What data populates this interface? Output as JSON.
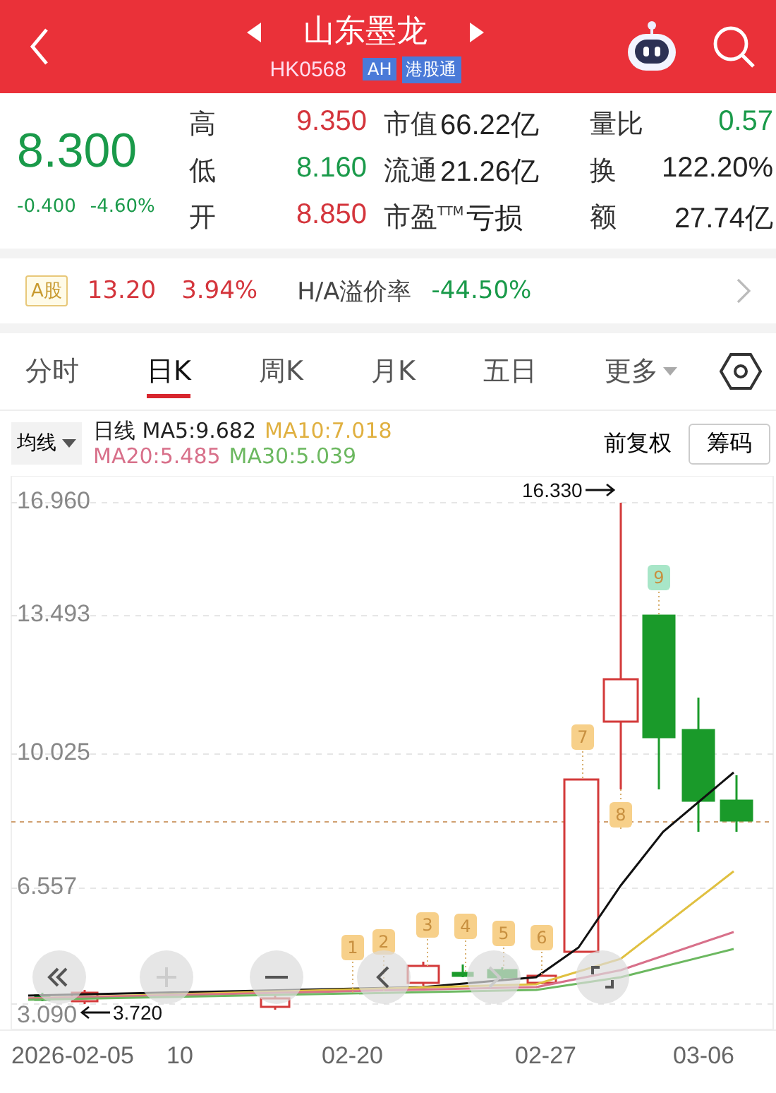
{
  "header": {
    "title": "山东墨龙",
    "code": "HK0568",
    "tags": [
      "AH",
      "港股通"
    ]
  },
  "quote": {
    "price": "8.300",
    "change": "-0.400",
    "change_pct": "-4.60%",
    "color": "#1a9a4a",
    "stats": [
      {
        "label": "高",
        "value": "9.350",
        "color": "#d4353c"
      },
      {
        "label": "市值",
        "value": "66.22亿",
        "color": "#222222"
      },
      {
        "label": "量比",
        "value": "0.57",
        "color": "#1a9a4a"
      },
      {
        "label": "低",
        "value": "8.160",
        "color": "#1a9a4a"
      },
      {
        "label": "流通",
        "value": "21.26亿",
        "color": "#222222"
      },
      {
        "label": "换",
        "value": "122.20%",
        "color": "#222222"
      },
      {
        "label": "开",
        "value": "8.850",
        "color": "#d4353c"
      },
      {
        "label": "市盈$^{TTM}$",
        "value": "亏损",
        "color": "#222222"
      },
      {
        "label": "额",
        "value": "27.74亿",
        "color": "#222222"
      }
    ]
  },
  "a_share": {
    "tag": "A股",
    "price": "13.20",
    "pct": "3.94%",
    "color": "#d4353c",
    "premium_label": "H/A溢价率",
    "premium": {
      "text": "-44.50%",
      "color": "#1a9a4a"
    }
  },
  "tabs": [
    {
      "label": "分时",
      "selected": false
    },
    {
      "label": "日K",
      "selected": true
    },
    {
      "label": "周K",
      "selected": false
    },
    {
      "label": "月K",
      "selected": false
    },
    {
      "label": "五日",
      "selected": false
    },
    {
      "label": "更多",
      "selected": false,
      "kind": "menu"
    }
  ],
  "indicators": {
    "dropdown": "均线",
    "lines": [
      {
        "text": "日线 MA5:9.682",
        "color": "#222222"
      },
      {
        "text": "MA10:7.018",
        "color": "#e0b040"
      },
      {
        "text": "MA20:5.485",
        "color": "#d8708a"
      },
      {
        "text": "MA30:5.039",
        "color": "#6cb860"
      }
    ],
    "adjust": "前复权",
    "chip": "筹码"
  },
  "chart": {
    "yticks": [
      "16.960",
      "13.493",
      "10.025",
      "6.557",
      "3.090"
    ],
    "high_note": "16.330",
    "low_note": "3.720",
    "xlabels": [
      "2026-02-05",
      "10",
      "02-20",
      "02-27",
      "03-06"
    ],
    "markers": [
      {
        "label": "1",
        "color": "#f7d08a"
      },
      {
        "label": "2",
        "color": "#f7d08a"
      },
      {
        "label": "3",
        "color": "#f7d08a"
      },
      {
        "label": "4",
        "color": "#f7d08a"
      },
      {
        "label": "5",
        "color": "#f7d08a"
      },
      {
        "label": "6",
        "color": "#f7d08a"
      },
      {
        "label": "7",
        "color": "#f7d08a"
      },
      {
        "label": "8",
        "color": "#f7d08a"
      },
      {
        "label": "9",
        "color": "#a8e6c8"
      }
    ]
  }
}
